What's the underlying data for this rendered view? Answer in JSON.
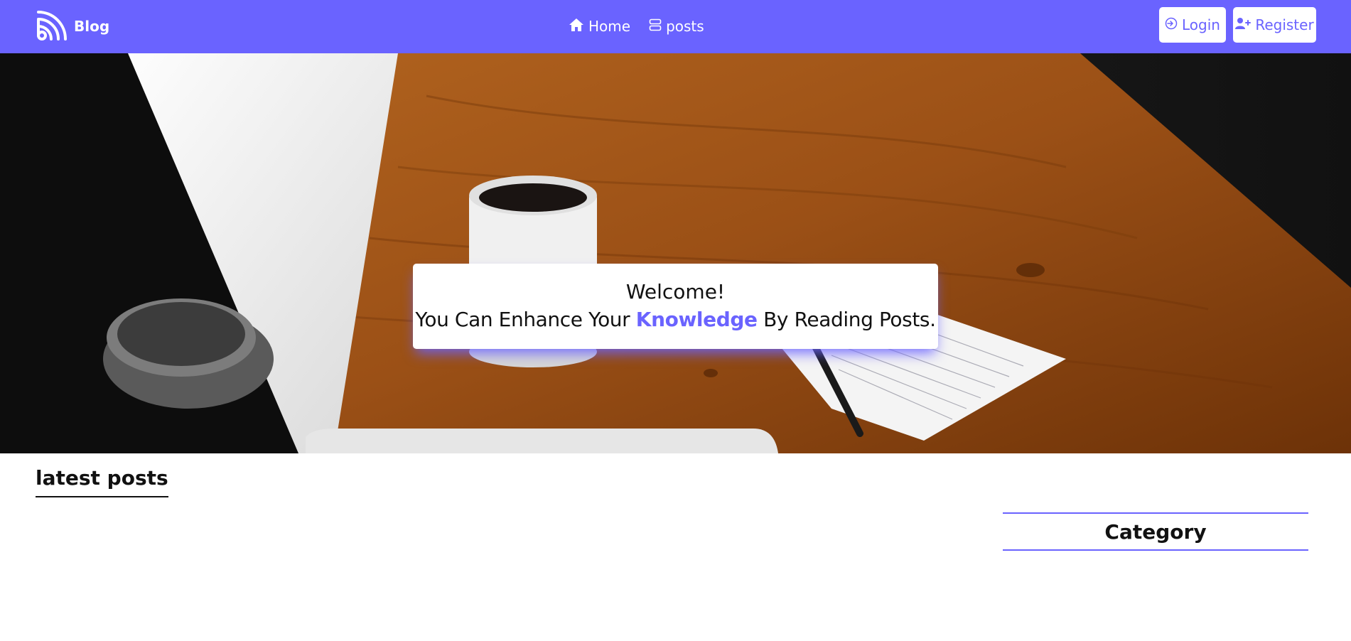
{
  "navbar": {
    "brand": "Blog",
    "links": [
      {
        "label": "Home",
        "icon": "home-icon"
      },
      {
        "label": "posts",
        "icon": "server-icon"
      }
    ],
    "login_label": "Login",
    "register_label": "Register",
    "colors": {
      "background": "#6a63ff",
      "text": "#ffffff"
    }
  },
  "hero": {
    "greeting": "Welcome!",
    "tagline_before": "You Can Enhance Your",
    "tagline_highlight": "Knowledge",
    "tagline_after": "By Reading Posts.",
    "highlight_color": "#6a63ff"
  },
  "main": {
    "latest_posts_title": "latest posts"
  },
  "sidebar": {
    "category_title": "Category",
    "accent_color": "#6a63ff"
  }
}
